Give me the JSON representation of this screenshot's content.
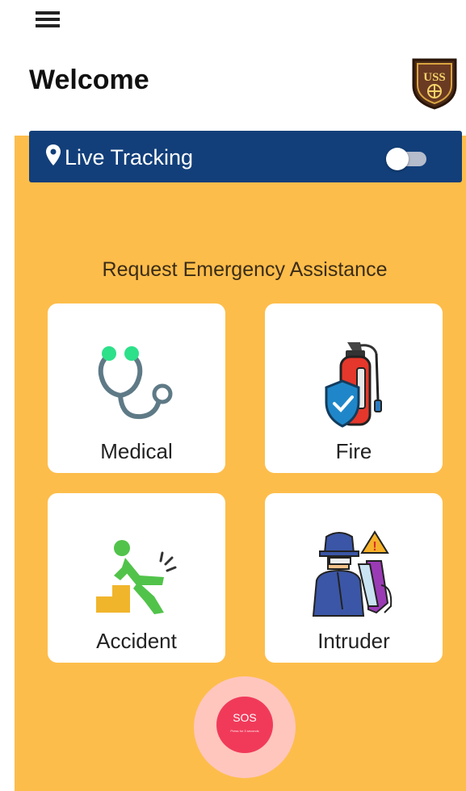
{
  "header": {
    "menu_icon": "hamburger-menu-icon",
    "title": "Welcome",
    "logo_text": "USS"
  },
  "tracking": {
    "label": "Live Tracking",
    "pin_icon": "location-pin-icon",
    "toggle_on": false
  },
  "emergency": {
    "title": "Request Emergency Assistance",
    "cards": [
      {
        "label": "Medical",
        "icon": "stethoscope-icon"
      },
      {
        "label": "Fire",
        "icon": "fire-extinguisher-icon"
      },
      {
        "label": "Accident",
        "icon": "falling-person-icon"
      },
      {
        "label": "Intruder",
        "icon": "intruder-icon"
      }
    ]
  },
  "sos": {
    "label": "SOS",
    "sublabel": "Press for 3 seconds"
  },
  "colors": {
    "panel": "#fdbd4b",
    "tracking_bar": "#123f7a",
    "sos": "#f13a5a"
  }
}
